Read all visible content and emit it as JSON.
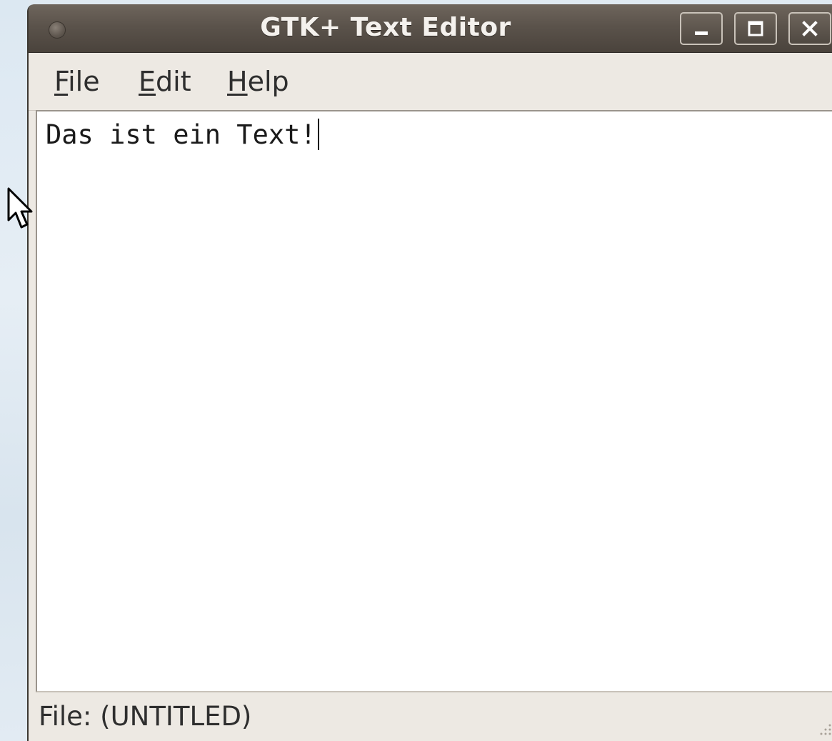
{
  "window": {
    "title": "GTK+ Text Editor",
    "controls": {
      "minimize_icon": "minimize-icon",
      "maximize_icon": "maximize-icon",
      "close_icon": "close-icon"
    }
  },
  "menubar": {
    "items": [
      {
        "mnemonic": "F",
        "rest": "ile"
      },
      {
        "mnemonic": "E",
        "rest": "dit"
      },
      {
        "mnemonic": "H",
        "rest": "elp"
      }
    ]
  },
  "editor": {
    "content": "Das ist ein Text!"
  },
  "statusbar": {
    "text": "File: (UNTITLED)"
  },
  "colors": {
    "titlebar": "#5b534b",
    "window_bg": "#ede9e3",
    "editor_bg": "#ffffff",
    "desktop": "#dfe9f1"
  }
}
